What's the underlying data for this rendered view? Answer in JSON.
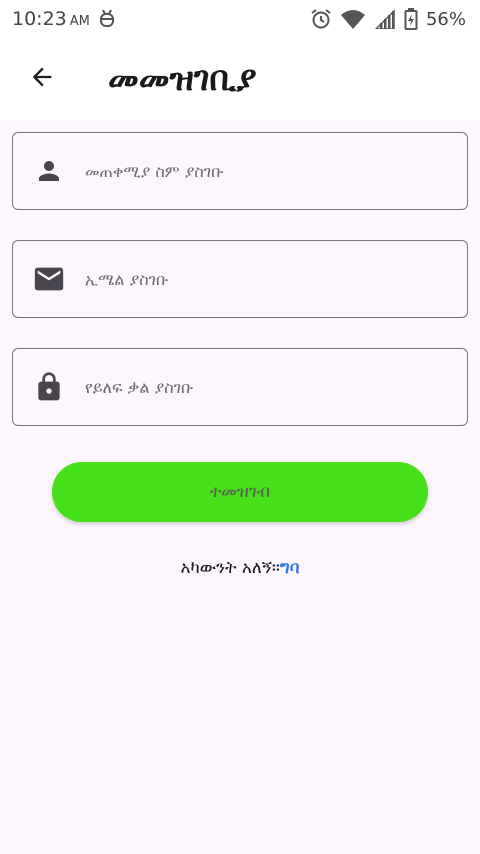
{
  "status_bar": {
    "time": "10:23",
    "time_suffix": "AM",
    "battery_percent": "56%",
    "icons": [
      "debug-bug-icon",
      "alarm-icon",
      "wifi-icon",
      "cell-signal-icon",
      "battery-charging-icon"
    ]
  },
  "app_bar": {
    "back_icon": "arrow-back-icon",
    "title": "መመዝገቢያ"
  },
  "form": {
    "username": {
      "icon": "person-icon",
      "placeholder": "መጠቀሚያ ስም ያስገቡ",
      "value": ""
    },
    "email": {
      "icon": "mail-icon",
      "placeholder": "ኢሜል ያስገቡ",
      "value": ""
    },
    "password": {
      "icon": "lock-icon",
      "placeholder": "የይለፍ ቃል ያስገቡ",
      "value": ""
    },
    "register_label": "ተመዝገብ"
  },
  "login": {
    "prompt": "አካውንት አለኝ።",
    "link": "ግባ"
  },
  "colors": {
    "background": "#fdf6fd",
    "button": "#45e01a",
    "link": "#2f7de1",
    "field_border": "#7a757f",
    "icon": "#49454f"
  }
}
